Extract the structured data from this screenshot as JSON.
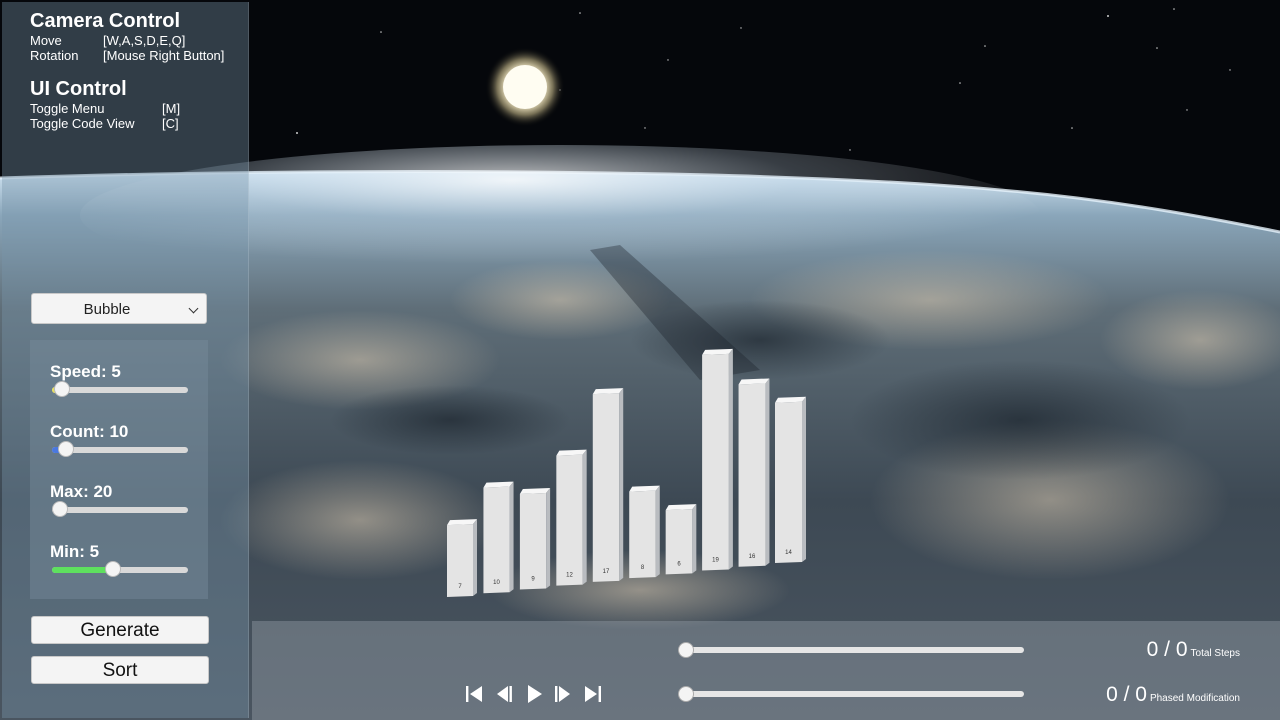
{
  "help": {
    "camera_title": "Camera Control",
    "move_label": "Move",
    "move_keys": "[W,A,S,D,E,Q]",
    "rotation_label": "Rotation",
    "rotation_keys": "[Mouse Right Button]",
    "ui_title": "UI Control",
    "toggle_menu_label": "Toggle Menu",
    "toggle_menu_key": "[M]",
    "toggle_code_label": "Toggle Code View",
    "toggle_code_key": "[C]"
  },
  "algorithm": {
    "selected": "Bubble"
  },
  "sliders": [
    {
      "label": "Speed: 5",
      "level": 0.07,
      "fill_color": "#e8e060"
    },
    {
      "label": "Count: 10",
      "level": 0.1,
      "fill_color": "#4a78e0"
    },
    {
      "label": "Max: 20",
      "level": 0.0,
      "fill_color": "#d9d9d9"
    },
    {
      "label": "Min: 5",
      "level": 0.45,
      "fill_color": "#5ee05e"
    }
  ],
  "buttons": {
    "generate": "Generate",
    "sort": "Sort"
  },
  "playback": {
    "total_steps_value": "0 / 0",
    "total_steps_label": "Total Steps",
    "phased_value": "0 / 0",
    "phased_label": "Phased Modification",
    "step_level": 0.0,
    "phase_level": 0.0
  },
  "bars": {
    "values": [
      7,
      10,
      9,
      12,
      17,
      8,
      6,
      19,
      16,
      14
    ],
    "labels": [
      "7",
      "10",
      "9",
      "12",
      "17",
      "8",
      "6",
      "19",
      "16",
      "14"
    ]
  },
  "colors": {
    "bar": "#e4e4e4",
    "panel": "#7896aa"
  }
}
